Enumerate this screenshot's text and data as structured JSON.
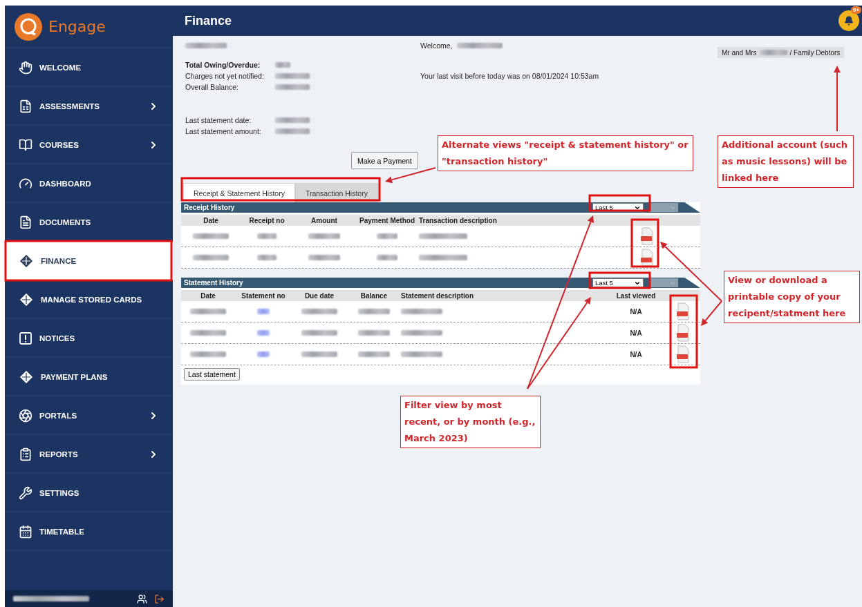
{
  "sidebar": {
    "brand": "Engage",
    "items": [
      {
        "label": "WELCOME",
        "selected": false,
        "has_submenu": false
      },
      {
        "label": "ASSESSMENTS",
        "selected": false,
        "has_submenu": true
      },
      {
        "label": "COURSES",
        "selected": false,
        "has_submenu": true
      },
      {
        "label": "DASHBOARD",
        "selected": false,
        "has_submenu": false
      },
      {
        "label": "DOCUMENTS",
        "selected": false,
        "has_submenu": false
      },
      {
        "label": "FINANCE",
        "selected": true,
        "has_submenu": false
      },
      {
        "label": "MANAGE STORED CARDS",
        "selected": false,
        "has_submenu": false
      },
      {
        "label": "NOTICES",
        "selected": false,
        "has_submenu": false
      },
      {
        "label": "PAYMENT PLANS",
        "selected": false,
        "has_submenu": false
      },
      {
        "label": "PORTALS",
        "selected": false,
        "has_submenu": true
      },
      {
        "label": "REPORTS",
        "selected": false,
        "has_submenu": true
      },
      {
        "label": "SETTINGS",
        "selected": false,
        "has_submenu": false
      },
      {
        "label": "TIMETABLE",
        "selected": false,
        "has_submenu": false
      }
    ]
  },
  "header": {
    "title": "Finance",
    "notification_badge": "9+"
  },
  "summary": {
    "balances": [
      {
        "label": "Total Owing/Overdue:",
        "bold": true
      },
      {
        "label": "Charges not yet notified:",
        "bold": false
      },
      {
        "label": "Overall Balance:",
        "bold": false
      }
    ],
    "statement": [
      {
        "label": "Last statement date:"
      },
      {
        "label": "Last statement amount:"
      }
    ],
    "welcome": "Welcome,",
    "last_visit": "Your last visit before today was on 08/01/2024 10:53am",
    "account": {
      "prefix": "Mr and Mrs",
      "suffix": "/ Family Debtors"
    }
  },
  "make_payment": "Make a Payment",
  "tabs": [
    {
      "label": "Receipt & Statement History",
      "selected": true
    },
    {
      "label": "Transaction History",
      "selected": false
    }
  ],
  "receipt_history": {
    "title": "Receipt History",
    "filter": "Last 5",
    "columns": [
      "Date",
      "Receipt no",
      "Amount",
      "Payment Method",
      "Transaction description"
    ],
    "rows": [
      {
        "cells": [
          {
            "kind": "redacted"
          },
          {
            "kind": "redacted"
          },
          {
            "kind": "redacted"
          },
          {
            "kind": "redacted"
          },
          {
            "kind": "redacted"
          }
        ],
        "pdf": true
      },
      {
        "cells": [
          {
            "kind": "redacted"
          },
          {
            "kind": "redacted"
          },
          {
            "kind": "redacted"
          },
          {
            "kind": "redacted"
          },
          {
            "kind": "redacted"
          }
        ],
        "pdf": true
      }
    ]
  },
  "statement_history": {
    "title": "Statement History",
    "filter": "Last 5",
    "columns": [
      "Date",
      "Statement no",
      "Due date",
      "Balance",
      "Statement description",
      "Last viewed"
    ],
    "rows": [
      {
        "cells": [
          {
            "kind": "redacted"
          },
          {
            "kind": "link"
          },
          {
            "kind": "redacted"
          },
          {
            "kind": "redacted"
          },
          {
            "kind": "redacted"
          },
          {
            "kind": "text",
            "text": "N/A"
          }
        ],
        "pdf": true
      },
      {
        "cells": [
          {
            "kind": "redacted"
          },
          {
            "kind": "link"
          },
          {
            "kind": "redacted"
          },
          {
            "kind": "redacted"
          },
          {
            "kind": "redacted"
          },
          {
            "kind": "text",
            "text": "N/A"
          }
        ],
        "pdf": true
      },
      {
        "cells": [
          {
            "kind": "redacted"
          },
          {
            "kind": "link"
          },
          {
            "kind": "redacted"
          },
          {
            "kind": "redacted"
          },
          {
            "kind": "redacted"
          },
          {
            "kind": "text",
            "text": "N/A"
          }
        ],
        "pdf": true
      }
    ],
    "button": "Last statement"
  },
  "annotations": [
    {
      "text": "Alternate views \"receipt & statement history\" or \"transaction history\""
    },
    {
      "text": "Additional account (such as music lessons) will be linked here"
    },
    {
      "text": "View or download a printable copy of your recipent/statment here"
    },
    {
      "text": "Filter view by most recent, or by month (e.g., March 2023)"
    }
  ]
}
